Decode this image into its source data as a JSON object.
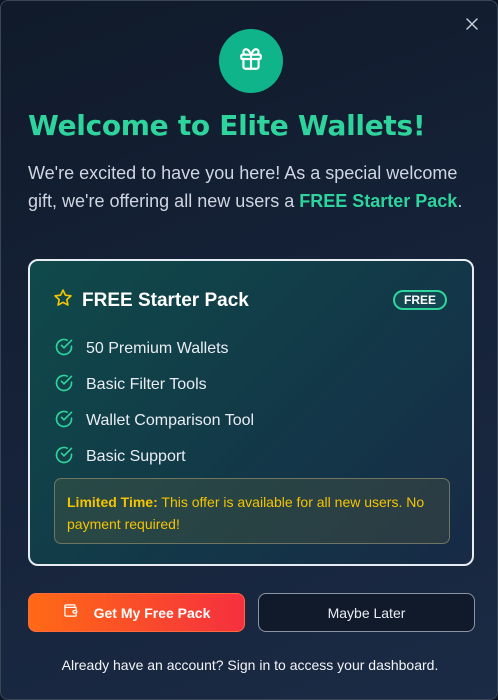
{
  "modal": {
    "close_icon": "close-icon",
    "gift_icon": "gift-icon",
    "accent_color": "#2fd39c",
    "title": "Welcome to Elite Wallets!",
    "intro": {
      "text_before": "We're excited to have you here! As a special welcome gift, we're offering all new users a ",
      "highlight": "FREE Starter Pack",
      "text_after": "."
    }
  },
  "pack": {
    "star_icon": "star-icon",
    "title": "FREE Starter Pack",
    "badge": "FREE",
    "features": [
      {
        "icon": "check-circle-icon",
        "label": "50 Premium Wallets"
      },
      {
        "icon": "check-circle-icon",
        "label": "Basic Filter Tools"
      },
      {
        "icon": "check-circle-icon",
        "label": "Wallet Comparison Tool"
      },
      {
        "icon": "check-circle-icon",
        "label": "Basic Support"
      }
    ],
    "notice": {
      "bold": "Limited Time:",
      "text": " This offer is available for all new users. No payment required!",
      "color": "#f5c400"
    }
  },
  "actions": {
    "primary_icon": "wallet-icon",
    "primary_label": "Get My Free Pack",
    "primary_gradient": [
      "#ff6a15",
      "#f5303f"
    ],
    "secondary_label": "Maybe Later"
  },
  "footer": {
    "text": "Already have an account? Sign in to access your dashboard."
  }
}
